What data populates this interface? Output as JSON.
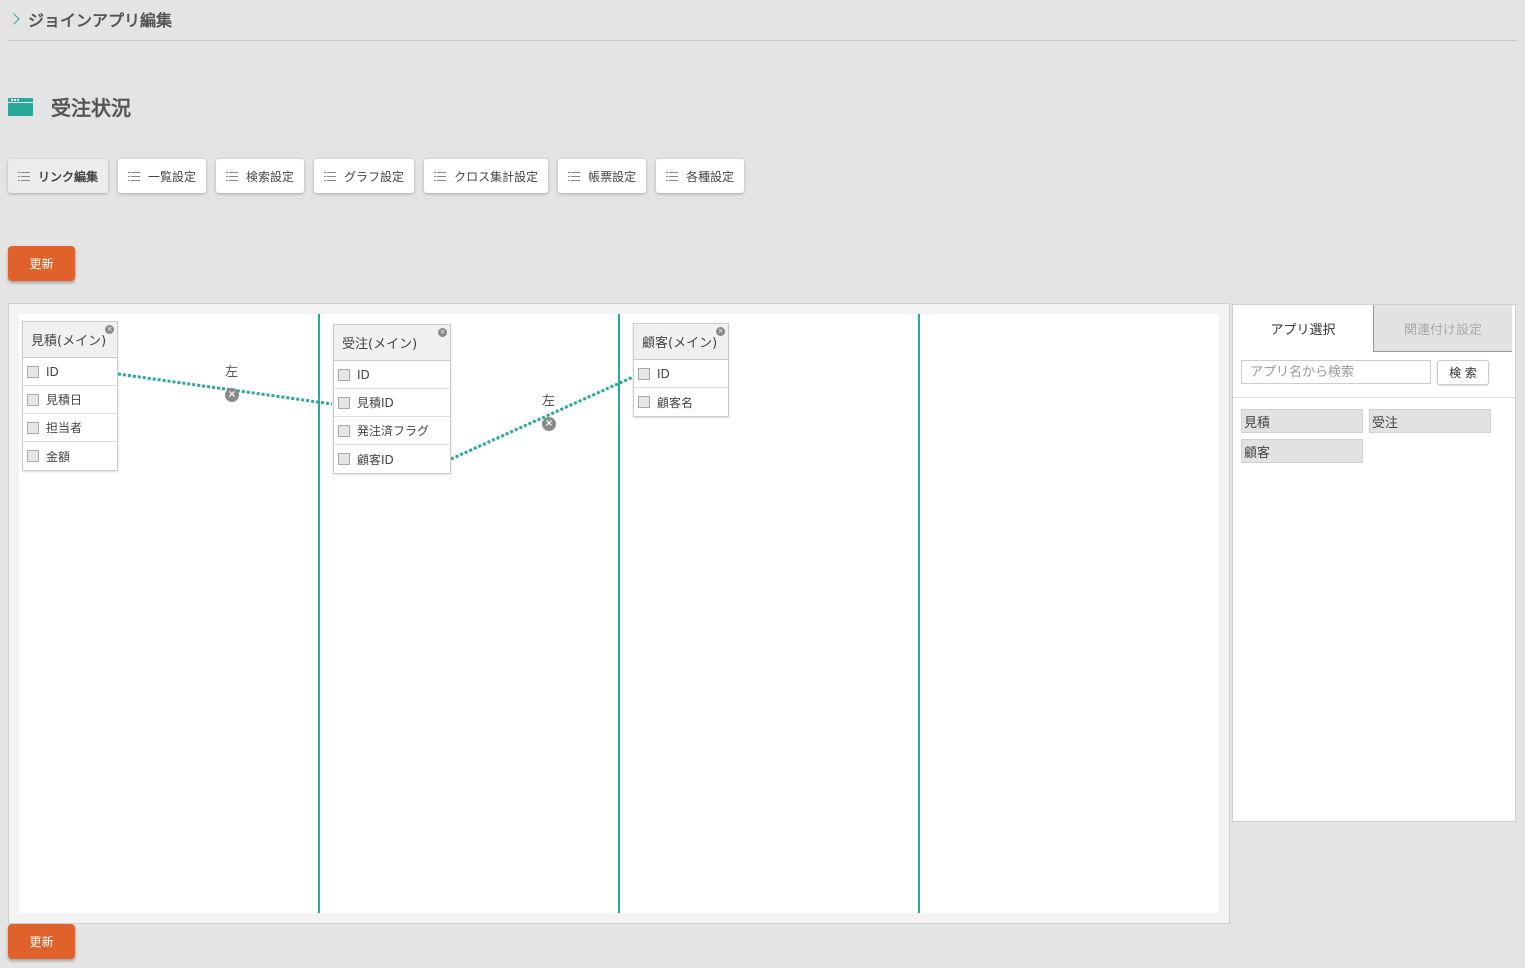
{
  "breadcrumb": {
    "label": "ジョインアプリ編集"
  },
  "page": {
    "title": "受注状況"
  },
  "tabs": [
    {
      "label": "リンク編集"
    },
    {
      "label": "一覧設定"
    },
    {
      "label": "検索設定"
    },
    {
      "label": "グラフ設定"
    },
    {
      "label": "クロス集計設定"
    },
    {
      "label": "帳票設定"
    },
    {
      "label": "各種設定"
    }
  ],
  "actions": {
    "update_label": "更新"
  },
  "nodes": [
    {
      "title": "見積(メイン)",
      "fields": [
        "ID",
        "見積日",
        "担当者",
        "金額"
      ]
    },
    {
      "title": "受注(メイン)",
      "fields": [
        "ID",
        "見積ID",
        "発注済フラグ",
        "顧客ID"
      ]
    },
    {
      "title": "顧客(メイン)",
      "fields": [
        "ID",
        "顧客名"
      ]
    }
  ],
  "links": [
    {
      "join_type": "左"
    },
    {
      "join_type": "左"
    }
  ],
  "side_panel": {
    "tabs": [
      {
        "label": "アプリ選択"
      },
      {
        "label": "関連付け設定"
      }
    ],
    "search_placeholder": "アプリ名から検索",
    "search_button": "検 索",
    "apps": [
      "見積",
      "受注",
      "顧客"
    ]
  },
  "colors": {
    "accent": "#2aa89a",
    "primary_button": "#e0622a"
  }
}
